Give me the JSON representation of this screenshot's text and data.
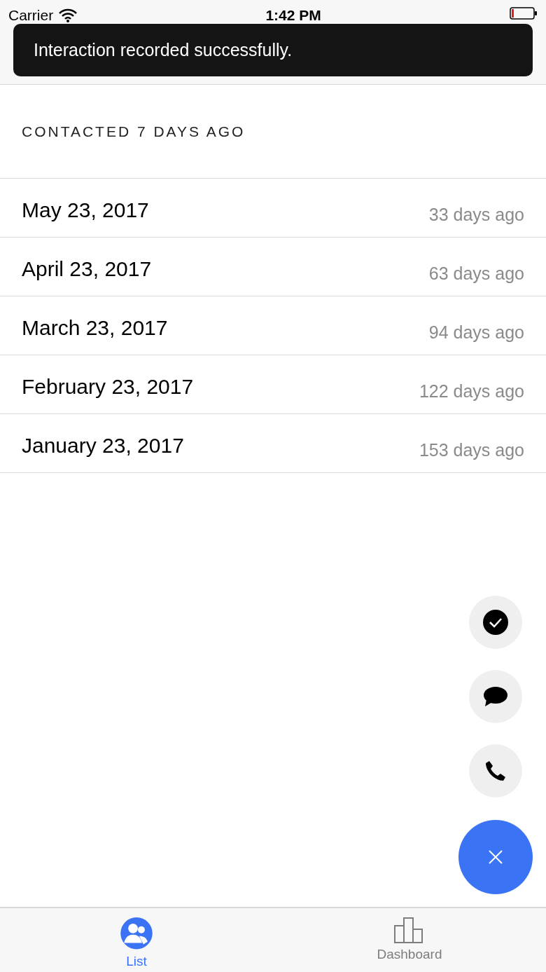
{
  "status_bar": {
    "carrier": "Carrier",
    "time": "1:42 PM"
  },
  "toast": {
    "message": "Interaction recorded successfully."
  },
  "section_header": "CONTACTED 7 DAYS AGO",
  "interactions": [
    {
      "date": "May 23, 2017",
      "ago": "33 days ago"
    },
    {
      "date": "April 23, 2017",
      "ago": "63 days ago"
    },
    {
      "date": "March 23, 2017",
      "ago": "94 days ago"
    },
    {
      "date": "February 23, 2017",
      "ago": "122 days ago"
    },
    {
      "date": "January 23, 2017",
      "ago": "153 days ago"
    }
  ],
  "actions": [
    {
      "kind": "check"
    },
    {
      "kind": "message"
    },
    {
      "kind": "call"
    }
  ],
  "tabs": [
    {
      "label": "List",
      "kind": "people",
      "selected": true
    },
    {
      "label": "Dashboard",
      "kind": "chart",
      "selected": false
    }
  ]
}
